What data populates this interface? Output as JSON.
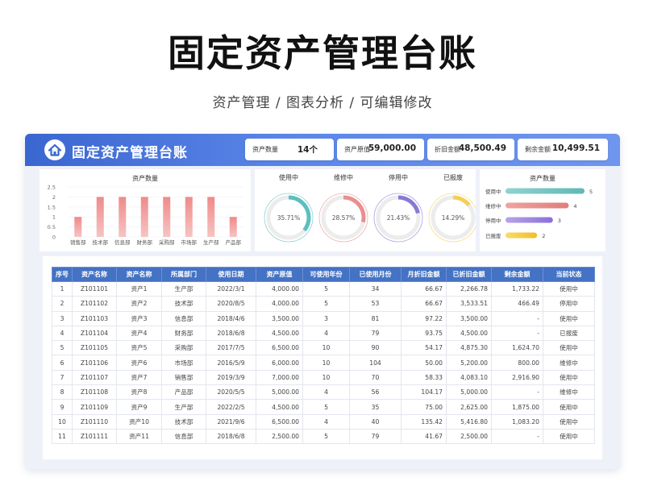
{
  "hero": {
    "title": "固定资产管理台账",
    "subtitle": "资产管理 / 图表分析 / 可编辑修改"
  },
  "header": {
    "title": "固定资产管理台账",
    "stats": [
      {
        "label": "资产数量",
        "value": "14个"
      },
      {
        "label": "资产原值",
        "value": "59,000.00"
      },
      {
        "label": "折旧金额",
        "value": "48,500.49"
      },
      {
        "label": "剩余金额",
        "value": "10,499.51"
      }
    ]
  },
  "colors": {
    "header": "#4472c4",
    "bar": "#e8908f",
    "accent": "#3a66d0"
  },
  "chart_data": [
    {
      "type": "bar",
      "title": "资产数量",
      "categories": [
        "销售部",
        "技术部",
        "信息部",
        "财务部",
        "采购部",
        "市场部",
        "生产部",
        "产品部"
      ],
      "values": [
        1,
        2,
        2,
        2,
        2,
        2,
        2,
        1
      ],
      "ylim": [
        0,
        2.5
      ],
      "yticks": [
        "0",
        "0.5",
        "1",
        "1.5",
        "2",
        "2.5"
      ]
    },
    {
      "type": "pie",
      "donuts": [
        {
          "label": "使用中",
          "percent": "35.71%",
          "value": 0.3571,
          "color": "#5bbfc0"
        },
        {
          "label": "维修中",
          "percent": "28.57%",
          "value": 0.2857,
          "color": "#ea8f8f"
        },
        {
          "label": "停用中",
          "percent": "21.43%",
          "value": 0.2143,
          "color": "#8a78d8"
        },
        {
          "label": "已报废",
          "percent": "14.29%",
          "value": 0.1429,
          "color": "#f3cf55"
        }
      ]
    },
    {
      "type": "bar",
      "title": "资产数量",
      "categories": [
        "使用中",
        "维修中",
        "停用中",
        "已报废"
      ],
      "values": [
        5,
        4,
        3,
        2
      ],
      "colors": [
        [
          "#8fd3d0",
          "#5fb8b6"
        ],
        [
          "#f0a3a0",
          "#e07d7a"
        ],
        [
          "#b8a2ea",
          "#8a6fd9"
        ],
        [
          "#f7dc6c",
          "#f0be2c"
        ]
      ]
    }
  ],
  "table": {
    "headers": [
      "序号",
      "资产名称",
      "资产名称",
      "所属部门",
      "使用日期",
      "资产原值",
      "可使用年份",
      "已使用月份",
      "月折旧金额",
      "已折旧金额",
      "剩余金额",
      "当前状态"
    ],
    "rows": [
      [
        "1",
        "Z101101",
        "资产1",
        "生产部",
        "2022/3/1",
        "4,000.00",
        "5",
        "34",
        "66.67",
        "2,266.78",
        "1,733.22",
        "使用中"
      ],
      [
        "2",
        "Z101102",
        "资产2",
        "技术部",
        "2020/8/5",
        "4,000.00",
        "5",
        "53",
        "66.67",
        "3,533.51",
        "466.49",
        "停用中"
      ],
      [
        "3",
        "Z101103",
        "资产3",
        "信息部",
        "2018/4/6",
        "3,500.00",
        "3",
        "81",
        "97.22",
        "3,500.00",
        "-",
        "使用中"
      ],
      [
        "4",
        "Z101104",
        "资产4",
        "财务部",
        "2018/6/8",
        "4,500.00",
        "4",
        "79",
        "93.75",
        "4,500.00",
        "-",
        "已报废"
      ],
      [
        "5",
        "Z101105",
        "资产5",
        "采购部",
        "2017/7/5",
        "6,500.00",
        "10",
        "90",
        "54.17",
        "4,875.30",
        "1,624.70",
        "使用中"
      ],
      [
        "6",
        "Z101106",
        "资产6",
        "市场部",
        "2016/5/9",
        "6,000.00",
        "10",
        "104",
        "50.00",
        "5,200.00",
        "800.00",
        "维修中"
      ],
      [
        "7",
        "Z101107",
        "资产7",
        "销售部",
        "2019/3/9",
        "7,000.00",
        "10",
        "70",
        "58.33",
        "4,083.10",
        "2,916.90",
        "使用中"
      ],
      [
        "8",
        "Z101108",
        "资产8",
        "产品部",
        "2020/5/5",
        "5,000.00",
        "4",
        "56",
        "104.17",
        "5,000.00",
        "-",
        "维修中"
      ],
      [
        "9",
        "Z101109",
        "资产9",
        "生产部",
        "2022/2/5",
        "4,500.00",
        "5",
        "35",
        "75.00",
        "2,625.00",
        "1,875.00",
        "使用中"
      ],
      [
        "10",
        "Z101110",
        "资产10",
        "技术部",
        "2021/9/6",
        "6,500.00",
        "4",
        "40",
        "135.42",
        "5,416.80",
        "1,083.20",
        "使用中"
      ],
      [
        "11",
        "Z101111",
        "资产11",
        "信息部",
        "2018/6/8",
        "2,500.00",
        "5",
        "79",
        "41.67",
        "2,500.00",
        "-",
        "使用中"
      ]
    ]
  }
}
